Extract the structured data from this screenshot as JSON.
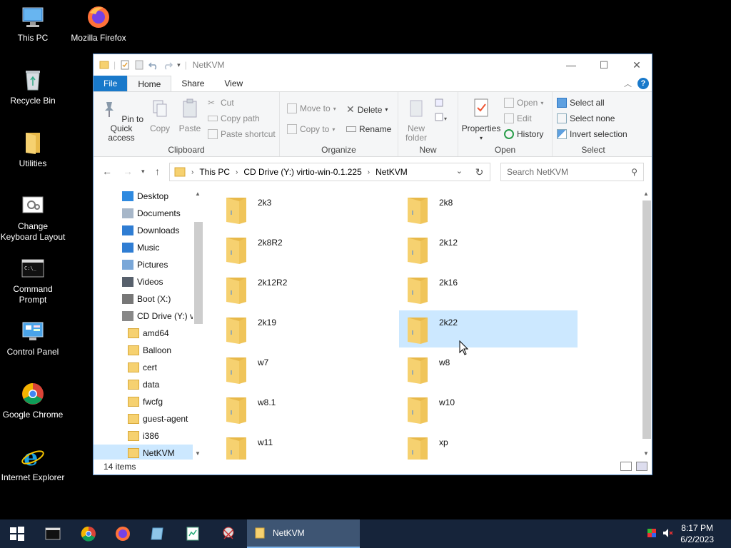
{
  "desktop": {
    "icons": [
      {
        "label": "This PC"
      },
      {
        "label": "Mozilla Firefox"
      },
      {
        "label": "Recycle Bin"
      },
      {
        "label": "Utilities"
      },
      {
        "label": "Change Keyboard Layout"
      },
      {
        "label": "Command Prompt"
      },
      {
        "label": "Control Panel"
      },
      {
        "label": "Google Chrome"
      },
      {
        "label": "Internet Explorer"
      }
    ]
  },
  "window": {
    "title": "NetKVM",
    "tabs": [
      "File",
      "Home",
      "Share",
      "View"
    ],
    "help_label": "?",
    "ribbon": {
      "clipboard": {
        "label": "Clipboard",
        "pin": "Pin to Quick access",
        "copy": "Copy",
        "paste": "Paste",
        "cut": "Cut",
        "copy_path": "Copy path",
        "paste_shortcut": "Paste shortcut"
      },
      "organize": {
        "label": "Organize",
        "move_to": "Move to",
        "copy_to": "Copy to",
        "delete": "Delete",
        "rename": "Rename"
      },
      "new": {
        "label": "New",
        "new_folder": "New folder"
      },
      "open": {
        "label": "Open",
        "properties": "Properties",
        "open": "Open",
        "edit": "Edit",
        "history": "History"
      },
      "select": {
        "label": "Select",
        "select_all": "Select all",
        "select_none": "Select none",
        "invert": "Invert selection"
      }
    },
    "address": {
      "crumbs": [
        "This PC",
        "CD Drive (Y:) virtio-win-0.1.225",
        "NetKVM"
      ]
    },
    "search": {
      "placeholder": "Search NetKVM"
    },
    "nav": [
      {
        "label": "Desktop"
      },
      {
        "label": "Documents"
      },
      {
        "label": "Downloads"
      },
      {
        "label": "Music"
      },
      {
        "label": "Pictures"
      },
      {
        "label": "Videos"
      },
      {
        "label": "Boot (X:)"
      },
      {
        "label": "CD Drive (Y:) virtio-win-0.1.225"
      },
      {
        "label": "amd64"
      },
      {
        "label": "Balloon"
      },
      {
        "label": "cert"
      },
      {
        "label": "data"
      },
      {
        "label": "fwcfg"
      },
      {
        "label": "guest-agent"
      },
      {
        "label": "i386"
      },
      {
        "label": "NetKVM"
      }
    ],
    "folders": [
      {
        "name": "2k3"
      },
      {
        "name": "2k8"
      },
      {
        "name": "2k8R2"
      },
      {
        "name": "2k12"
      },
      {
        "name": "2k12R2"
      },
      {
        "name": "2k16"
      },
      {
        "name": "2k19"
      },
      {
        "name": "2k22"
      },
      {
        "name": "w7"
      },
      {
        "name": "w8"
      },
      {
        "name": "w8.1"
      },
      {
        "name": "w10"
      },
      {
        "name": "w11"
      },
      {
        "name": "xp"
      }
    ],
    "status": "14 items"
  },
  "taskbar": {
    "window_label": "NetKVM",
    "time": "8:17 PM",
    "date": "6/2/2023"
  },
  "colors": {
    "accent": "#1979ca",
    "selection": "#cce8ff",
    "taskbar": "#16243a",
    "folder": "#f6d170"
  }
}
